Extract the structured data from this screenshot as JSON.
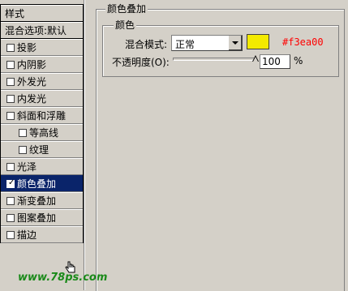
{
  "sidebar": {
    "header": "样式",
    "blend_options": "混合选项:默认",
    "items": [
      {
        "label": "投影",
        "checked": false,
        "indent": false
      },
      {
        "label": "内阴影",
        "checked": false,
        "indent": false
      },
      {
        "label": "外发光",
        "checked": false,
        "indent": false
      },
      {
        "label": "内发光",
        "checked": false,
        "indent": false
      },
      {
        "label": "斜面和浮雕",
        "checked": false,
        "indent": false
      },
      {
        "label": "等高线",
        "checked": false,
        "indent": true
      },
      {
        "label": "纹理",
        "checked": false,
        "indent": true
      },
      {
        "label": "光泽",
        "checked": false,
        "indent": false
      },
      {
        "label": "颜色叠加",
        "checked": true,
        "indent": false,
        "selected": true
      },
      {
        "label": "渐变叠加",
        "checked": false,
        "indent": false
      },
      {
        "label": "图案叠加",
        "checked": false,
        "indent": false
      },
      {
        "label": "描边",
        "checked": false,
        "indent": false
      }
    ]
  },
  "panel": {
    "title": "颜色叠加",
    "group_title": "颜色",
    "blend_mode_label": "混合模式:",
    "blend_mode_value": "正常",
    "overlay_color": "#f3ea00",
    "hex_label": "#f3ea00",
    "hex_label_color": "#ff0000",
    "opacity_label": "不透明度(O):",
    "opacity_value": "100",
    "opacity_fraction": 1.0,
    "opacity_unit": "%"
  },
  "watermark": "www.78ps.com"
}
